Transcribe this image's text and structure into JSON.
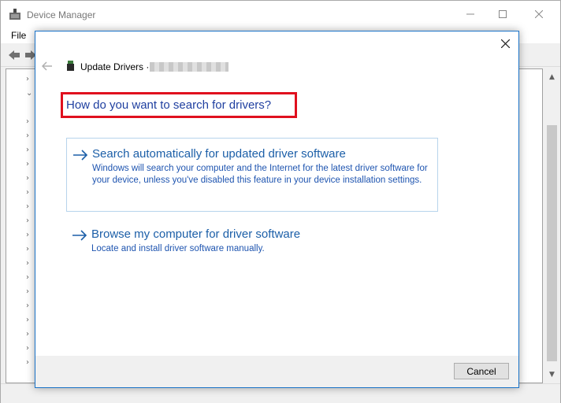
{
  "window": {
    "title": "Device Manager",
    "menu": [
      "File"
    ],
    "caption_buttons": [
      "minimize-icon",
      "maximize-icon",
      "close-icon"
    ]
  },
  "dialog": {
    "heading": "Update Drivers ·",
    "device_name_redacted": true,
    "question": "How do you want to search for drivers?",
    "options": [
      {
        "title": "Search automatically for updated driver software",
        "description": "Windows will search your computer and the Internet for the latest driver software for your device, unless you've disabled this feature in your device installation settings.",
        "focused": true
      },
      {
        "title": "Browse my computer for driver software",
        "description": "Locate and install driver software manually.",
        "focused": false
      }
    ],
    "cancel_label": "Cancel",
    "highlight_color": "#e0101e",
    "link_color": "#1c5fa8"
  }
}
